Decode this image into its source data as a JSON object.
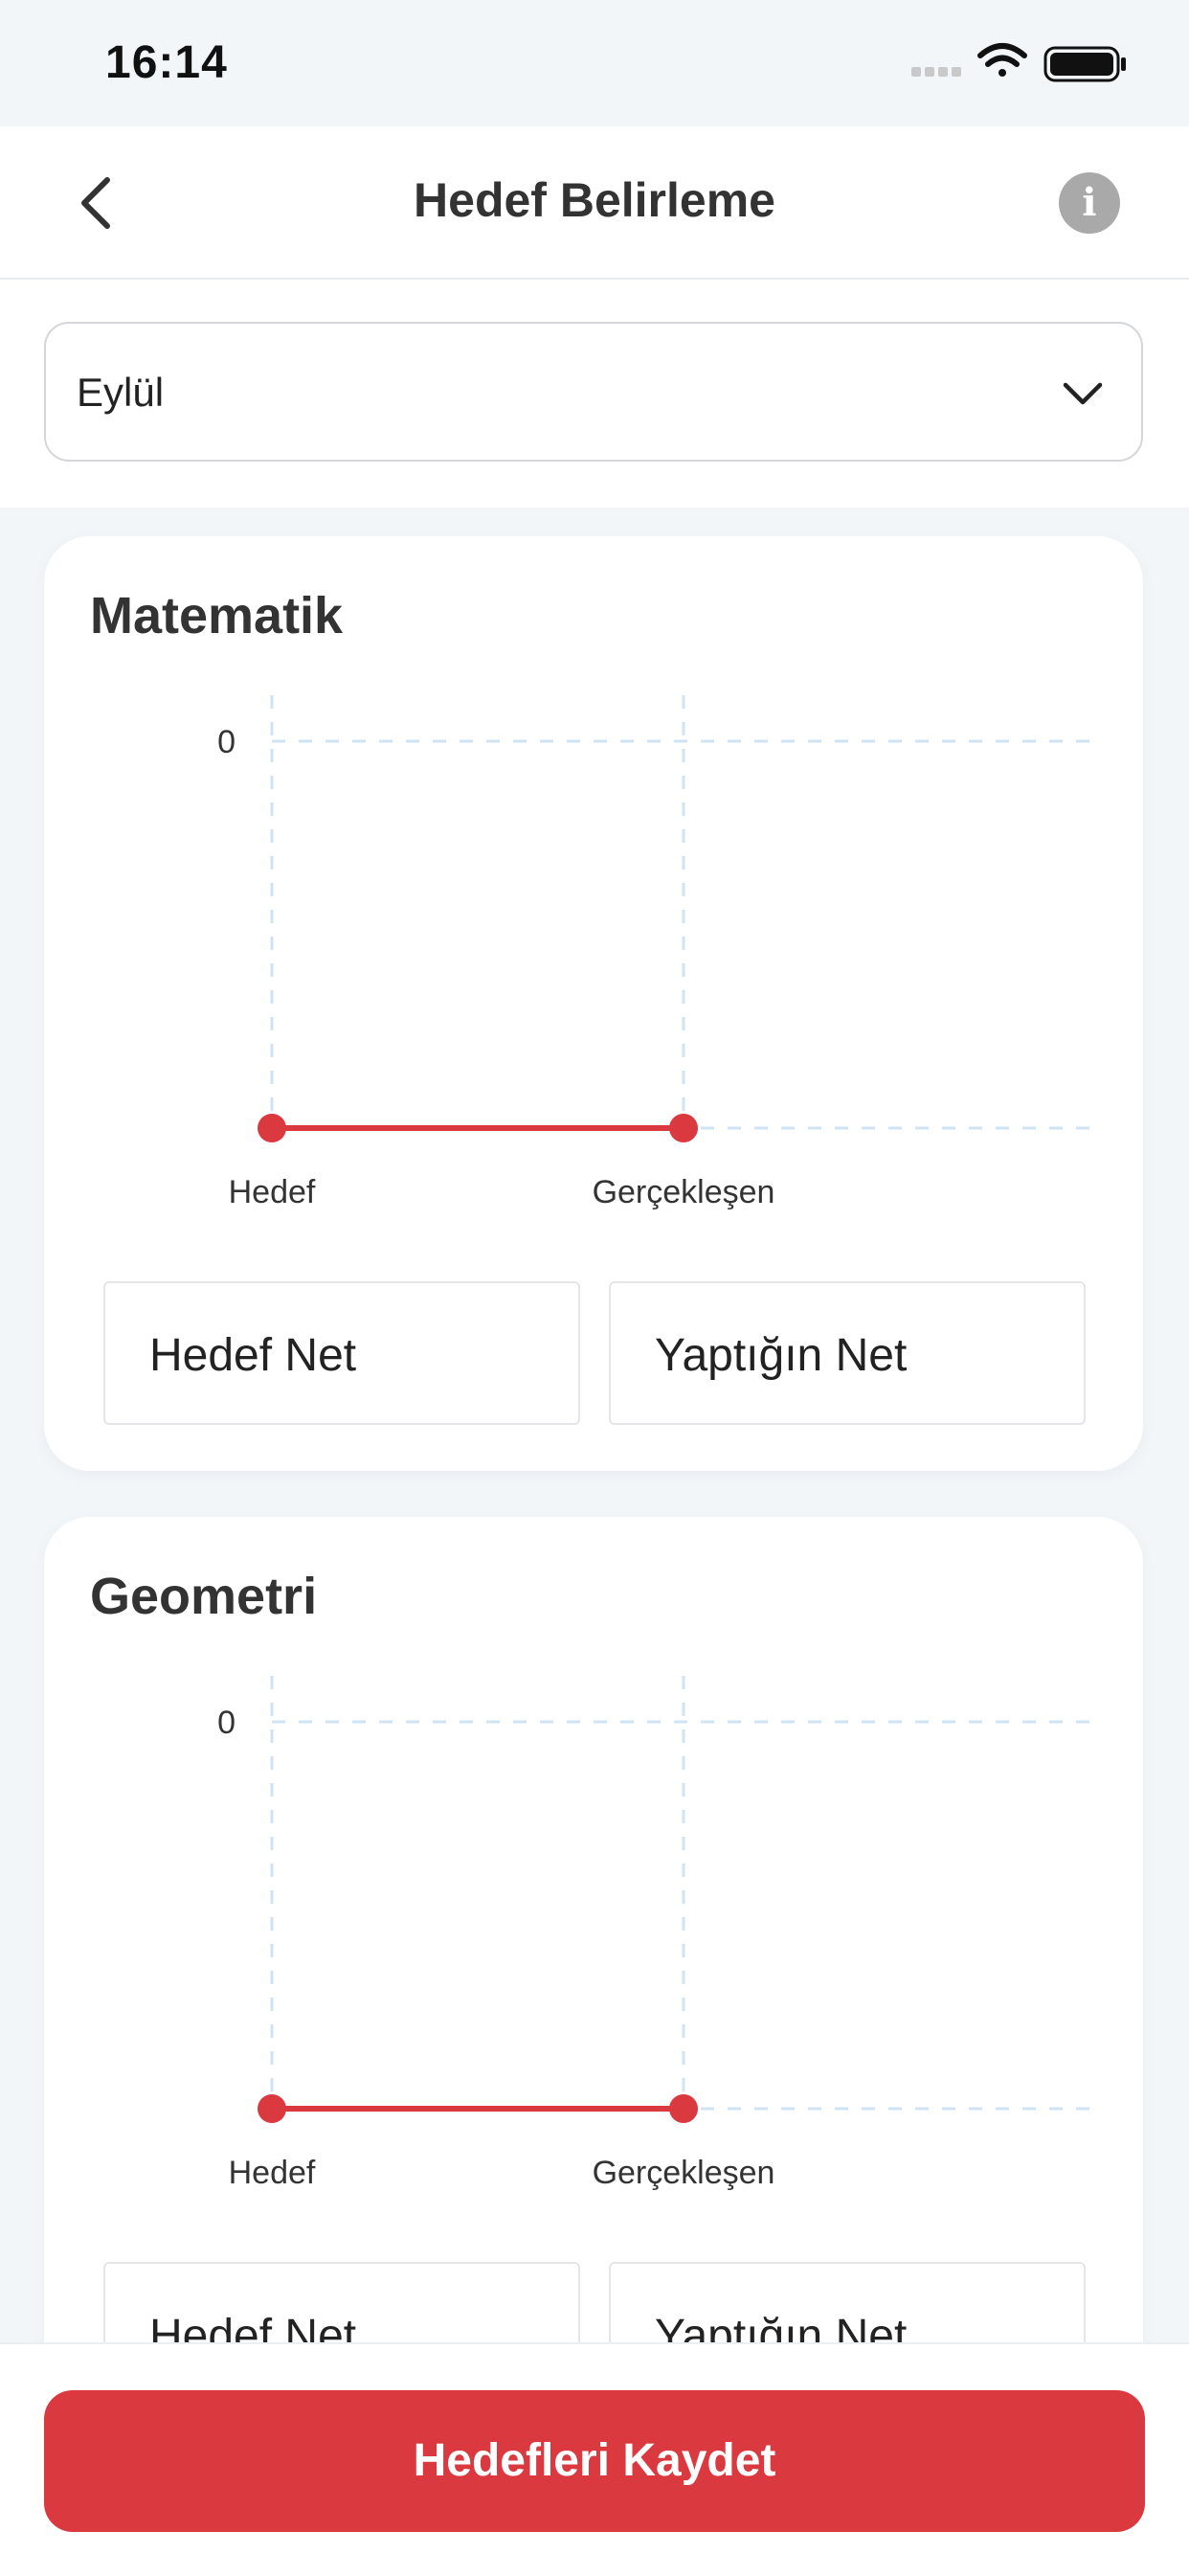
{
  "status_bar": {
    "time": "16:14"
  },
  "header": {
    "title": "Hedef Belirleme",
    "back_icon": "chevron-left-icon",
    "info_icon": "info-icon",
    "info_glyph": "i"
  },
  "month_select": {
    "selected": "Eylül",
    "icon": "chevron-down-icon"
  },
  "cards": [
    {
      "title": "Matematik",
      "target_net_placeholder": "Hedef Net",
      "actual_net_placeholder": "Yaptığın Net",
      "chart_data": {
        "type": "line",
        "categories": [
          "Hedef",
          "Gerçekleşen"
        ],
        "values": [
          0,
          0
        ],
        "y_tick_labels": [
          "0"
        ],
        "color": "#d9393f",
        "grid": true
      }
    },
    {
      "title": "Geometri",
      "target_net_placeholder": "Hedef Net",
      "actual_net_placeholder": "Yaptığın Net",
      "chart_data": {
        "type": "line",
        "categories": [
          "Hedef",
          "Gerçekleşen"
        ],
        "values": [
          0,
          0
        ],
        "y_tick_labels": [
          "0"
        ],
        "color": "#d9393f",
        "grid": true
      }
    }
  ],
  "footer": {
    "save_label": "Hedefleri Kaydet"
  },
  "colors": {
    "accent": "#d9393f",
    "background": "#f3f6f9",
    "grid": "#cfe3f3"
  }
}
